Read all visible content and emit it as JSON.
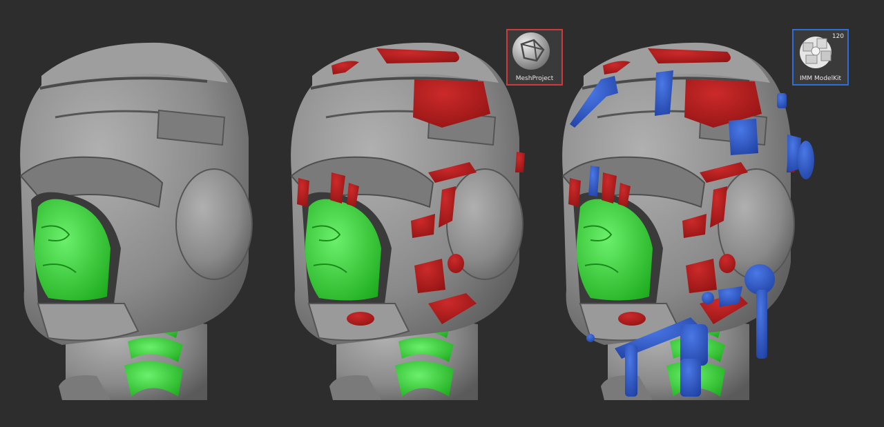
{
  "colors": {
    "background": "#2d2d2d",
    "helmet_gray": "#8e8e8e",
    "face_green": "#2fd12f",
    "red_panels": "#b01a1a",
    "blue_parts": "#2b54c9",
    "meshproject_border": "#d23a3a",
    "modelkit_border": "#2d6fd9"
  },
  "brushes": [
    {
      "label": "MeshProject",
      "icon": "sphere-mesh-icon",
      "count": "",
      "border_color": "#d23a3a"
    },
    {
      "label": "IMM ModelKit",
      "icon": "kitbash-parts-icon",
      "count": "120",
      "border_color": "#2d6fd9"
    }
  ],
  "models": [
    {
      "stage": "base",
      "parts": [
        "gray-helmet",
        "green-face",
        "green-neck-inlays"
      ]
    },
    {
      "stage": "projected",
      "parts": [
        "gray-helmet",
        "green-face",
        "green-neck-inlays",
        "red-panels"
      ]
    },
    {
      "stage": "kitbashed",
      "parts": [
        "gray-helmet",
        "green-face",
        "green-neck-inlays",
        "red-panels",
        "blue-mechanical-parts"
      ]
    }
  ]
}
